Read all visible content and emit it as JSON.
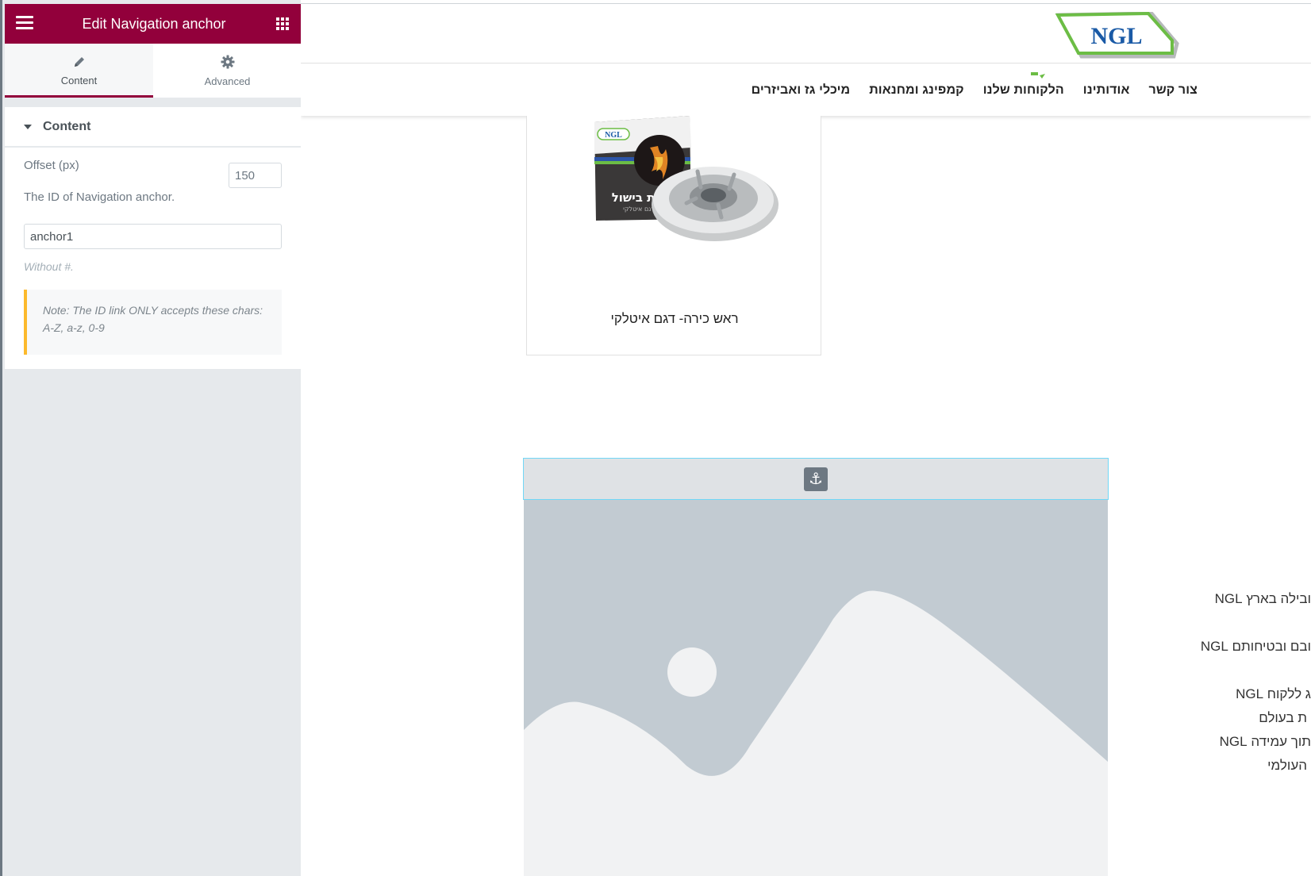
{
  "panel": {
    "header_title": "Edit Navigation anchor",
    "tabs": [
      {
        "label": "Content",
        "icon": "pencil-icon",
        "active": true
      },
      {
        "label": "Advanced",
        "icon": "gear-icon",
        "active": false
      }
    ],
    "section_title": "Content",
    "offset_label": "Offset (px)",
    "offset_value": "150",
    "id_label": "The ID of Navigation anchor.",
    "id_value": "anchor1",
    "id_help": "Without #.",
    "note": "Note: The ID link ONLY accepts these chars: A-Z, a-z, 0-9",
    "accent_color": "#92003b",
    "collapse_icon": "‹"
  },
  "site": {
    "logo_text": "NGL",
    "nav_items": [
      "צור קשר",
      "אודותינו",
      "הלקוחות שלנו",
      "קמפינג ומחנאות",
      "מיכלי גז ואביזרים"
    ],
    "product": {
      "title": "ראש כירה- דגם איטלקי",
      "box_text": "כירת בישול",
      "box_subtext": "דגם איטלקי",
      "box_logo": "NGL"
    },
    "anchor_icon": "⚓",
    "side_texts": [
      "ובילה בארץ NGL",
      "ובם ובטיחותם NGL",
      "ג ללקוח NGL",
      "ת בעולם",
      "תוך עמידה NGL",
      "העולמי"
    ]
  }
}
